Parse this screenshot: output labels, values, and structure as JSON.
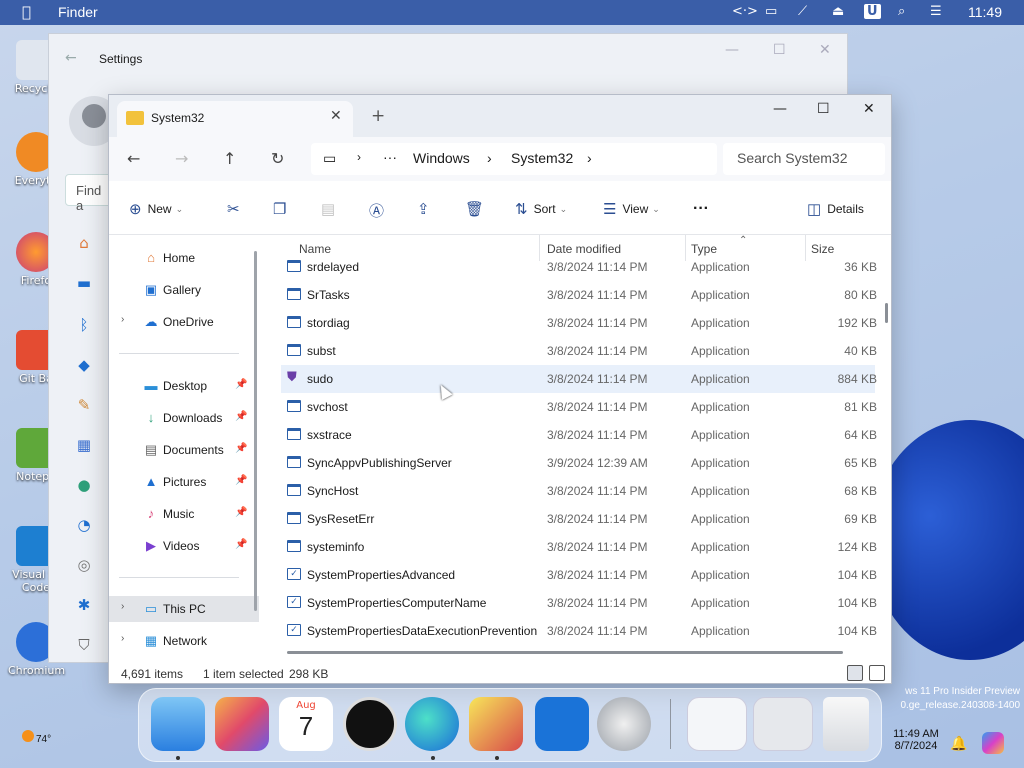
{
  "menubar": {
    "app_name": "Finder",
    "clock": "11:49",
    "icons": [
      "apple-icon",
      "code-icon",
      "monitor-icon",
      "no-wifi-icon",
      "eject-icon",
      "user-u-icon",
      "search-icon",
      "control-center-icon"
    ]
  },
  "desktop": {
    "icons": [
      "Recycle",
      "Everyth",
      "Firefo",
      "Git Ba",
      "Notepa",
      "Visual St\nCode",
      "Chromium"
    ],
    "watermark_line1": "ws 11 Pro Insider Preview",
    "watermark_line2": "0.ge_release.240308-1400"
  },
  "settings": {
    "title": "Settings",
    "find_placeholder": "Find a"
  },
  "explorer": {
    "tab_title": "System32",
    "breadcrumb": [
      "Windows",
      "System32"
    ],
    "search_placeholder": "Search System32",
    "toolbar": {
      "new_label": "New",
      "sort_label": "Sort",
      "view_label": "View",
      "details_label": "Details"
    },
    "nav": {
      "home": "Home",
      "gallery": "Gallery",
      "onedrive": "OneDrive",
      "desktop": "Desktop",
      "downloads": "Downloads",
      "documents": "Documents",
      "pictures": "Pictures",
      "music": "Music",
      "videos": "Videos",
      "this_pc": "This PC",
      "network": "Network"
    },
    "columns": {
      "name": "Name",
      "date": "Date modified",
      "type": "Type",
      "size": "Size"
    },
    "files": [
      {
        "name": "srdelayed",
        "date": "3/8/2024 11:14 PM",
        "type": "Application",
        "size": "36 KB",
        "icon": "app"
      },
      {
        "name": "SrTasks",
        "date": "3/8/2024 11:14 PM",
        "type": "Application",
        "size": "80 KB",
        "icon": "app"
      },
      {
        "name": "stordiag",
        "date": "3/8/2024 11:14 PM",
        "type": "Application",
        "size": "192 KB",
        "icon": "app"
      },
      {
        "name": "subst",
        "date": "3/8/2024 11:14 PM",
        "type": "Application",
        "size": "40 KB",
        "icon": "app"
      },
      {
        "name": "sudo",
        "date": "3/8/2024 11:14 PM",
        "type": "Application",
        "size": "884 KB",
        "icon": "shield"
      },
      {
        "name": "svchost",
        "date": "3/8/2024 11:14 PM",
        "type": "Application",
        "size": "81 KB",
        "icon": "app"
      },
      {
        "name": "sxstrace",
        "date": "3/8/2024 11:14 PM",
        "type": "Application",
        "size": "64 KB",
        "icon": "app"
      },
      {
        "name": "SyncAppvPublishingServer",
        "date": "3/9/2024 12:39 AM",
        "type": "Application",
        "size": "65 KB",
        "icon": "app"
      },
      {
        "name": "SyncHost",
        "date": "3/8/2024 11:14 PM",
        "type": "Application",
        "size": "68 KB",
        "icon": "app"
      },
      {
        "name": "SysResetErr",
        "date": "3/8/2024 11:14 PM",
        "type": "Application",
        "size": "69 KB",
        "icon": "app"
      },
      {
        "name": "systeminfo",
        "date": "3/8/2024 11:14 PM",
        "type": "Application",
        "size": "124 KB",
        "icon": "app"
      },
      {
        "name": "SystemPropertiesAdvanced",
        "date": "3/8/2024 11:14 PM",
        "type": "Application",
        "size": "104 KB",
        "icon": "gear"
      },
      {
        "name": "SystemPropertiesComputerName",
        "date": "3/8/2024 11:14 PM",
        "type": "Application",
        "size": "104 KB",
        "icon": "gear"
      },
      {
        "name": "SystemPropertiesDataExecutionPrevention",
        "date": "3/8/2024 11:14 PM",
        "type": "Application",
        "size": "104 KB",
        "icon": "gear"
      }
    ],
    "status": {
      "items": "4,691 items",
      "selected": "1 item selected",
      "size": "298 KB"
    }
  },
  "dock": {
    "calendar_month": "Aug",
    "calendar_day": "7"
  },
  "taskbar": {
    "weather": "74°",
    "time": "11:49 AM",
    "date": "8/7/2024"
  }
}
